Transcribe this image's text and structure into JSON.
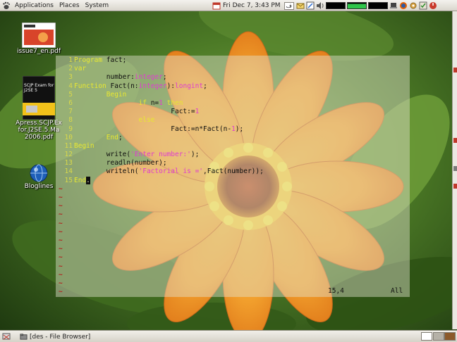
{
  "top_panel": {
    "menus": [
      "Applications",
      "Places",
      "System"
    ],
    "clock": "Fri Dec  7,  3:43 PM",
    "keyboard_layout": "ف"
  },
  "desktop_icons": [
    {
      "label_lines": [
        "issue7_en.pdf"
      ],
      "icon": "pdf-thumbnail-icon"
    },
    {
      "label_lines": [
        "Apress.SCJP.Ex",
        "for.J2SE.5.Ma",
        "2006.pdf"
      ],
      "icon": "book-cover-icon",
      "cover_title": "SCJP Exam for J2SE 5"
    },
    {
      "label_lines": [
        "Bloglines"
      ],
      "icon": "globe-icon"
    }
  ],
  "editor": {
    "lines": [
      {
        "n": "1",
        "parts": [
          {
            "t": "Program ",
            "c": "kw"
          },
          {
            "t": "fact;",
            "c": "tx"
          }
        ]
      },
      {
        "n": "2",
        "parts": [
          {
            "t": "var",
            "c": "kw"
          }
        ]
      },
      {
        "n": "3",
        "parts": [
          {
            "t": "        number:",
            "c": "tx"
          },
          {
            "t": "integer",
            "c": "ty"
          },
          {
            "t": ";",
            "c": "tx"
          }
        ]
      },
      {
        "n": "4",
        "parts": [
          {
            "t": "Function ",
            "c": "kw"
          },
          {
            "t": "Fact(n:",
            "c": "tx"
          },
          {
            "t": "integer",
            "c": "ty"
          },
          {
            "t": "):",
            "c": "tx"
          },
          {
            "t": "longint",
            "c": "ty"
          },
          {
            "t": ";",
            "c": "tx"
          }
        ]
      },
      {
        "n": "5",
        "parts": [
          {
            "t": "        ",
            "c": "tx"
          },
          {
            "t": "Begin",
            "c": "kw"
          }
        ]
      },
      {
        "n": "6",
        "parts": [
          {
            "t": "                ",
            "c": "tx"
          },
          {
            "t": "if ",
            "c": "kw"
          },
          {
            "t": "n=",
            "c": "tx"
          },
          {
            "t": "1",
            "c": "nm"
          },
          {
            "t": " then",
            "c": "kw"
          }
        ]
      },
      {
        "n": "7",
        "parts": [
          {
            "t": "                        Fact:=",
            "c": "tx"
          },
          {
            "t": "1",
            "c": "nm"
          }
        ]
      },
      {
        "n": "8",
        "parts": [
          {
            "t": "                ",
            "c": "tx"
          },
          {
            "t": "else",
            "c": "kw"
          }
        ]
      },
      {
        "n": "9",
        "parts": [
          {
            "t": "                        Fact:=n*Fact(n-",
            "c": "tx"
          },
          {
            "t": "1",
            "c": "nm"
          },
          {
            "t": ");",
            "c": "tx"
          }
        ]
      },
      {
        "n": "10",
        "parts": [
          {
            "t": "        ",
            "c": "tx"
          },
          {
            "t": "End",
            "c": "kw"
          },
          {
            "t": ";",
            "c": "tx"
          }
        ]
      },
      {
        "n": "11",
        "parts": [
          {
            "t": "Begin",
            "c": "kw"
          }
        ]
      },
      {
        "n": "12",
        "parts": [
          {
            "t": "        write(",
            "c": "tx"
          },
          {
            "t": "'Enter number:'",
            "c": "str"
          },
          {
            "t": ");",
            "c": "tx"
          }
        ]
      },
      {
        "n": "13",
        "parts": [
          {
            "t": "        readln(number);",
            "c": "tx"
          }
        ]
      },
      {
        "n": "14",
        "parts": [
          {
            "t": "        writeln(",
            "c": "tx"
          },
          {
            "t": "'Factorial is ='",
            "c": "str"
          },
          {
            "t": ",Fact(number));",
            "c": "tx"
          }
        ]
      },
      {
        "n": "15",
        "parts": [
          {
            "t": "End",
            "c": "kw"
          },
          {
            "t": ".",
            "c": "cursor"
          }
        ]
      }
    ],
    "tilde_count": 13,
    "status_position": "15,4",
    "status_scroll": "All"
  },
  "bottom_panel": {
    "task_label": "[des - File Browser]"
  },
  "colors": {
    "keyword": "#e8e830",
    "type": "#e03bd0",
    "line_number": "#d9d94a",
    "tilde": "#b0251f"
  }
}
